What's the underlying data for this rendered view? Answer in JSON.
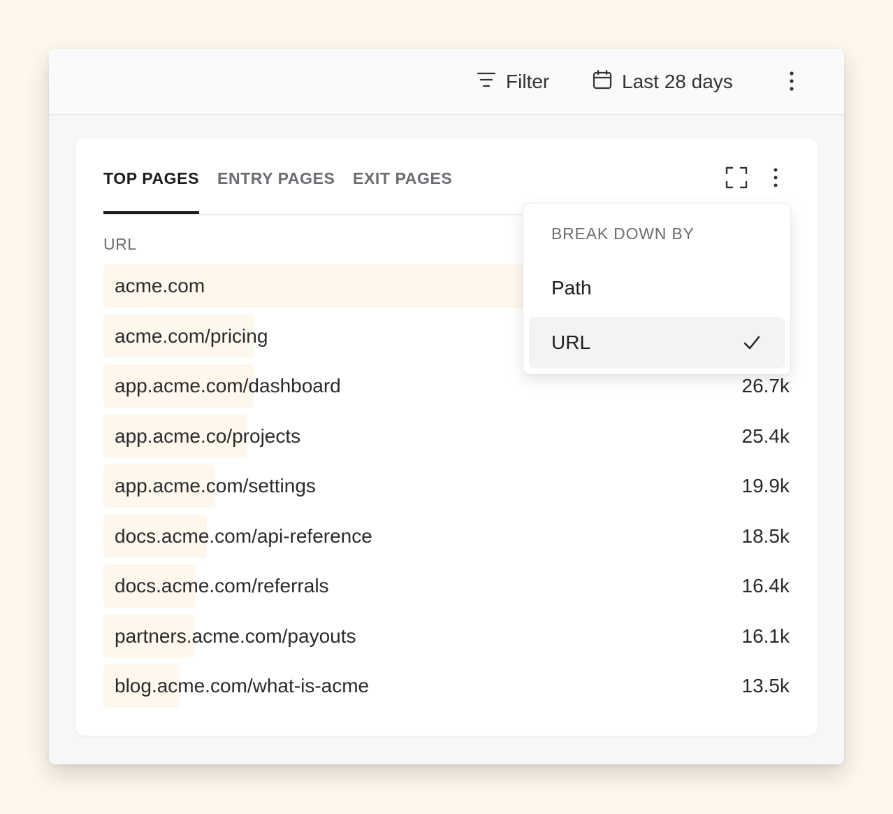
{
  "toolbar": {
    "filter_label": "Filter",
    "date_range_label": "Last 28 days"
  },
  "tabs": [
    {
      "label": "TOP PAGES",
      "active": true
    },
    {
      "label": "ENTRY PAGES",
      "active": false
    },
    {
      "label": "EXIT PAGES",
      "active": false
    }
  ],
  "table": {
    "column_header": "URL",
    "rows": [
      {
        "label": "acme.com",
        "value": "",
        "share": 1.0
      },
      {
        "label": "acme.com/pricing",
        "value": "",
        "share": 0.22
      },
      {
        "label": "app.acme.com/dashboard",
        "value": "26.7k",
        "share": 0.22
      },
      {
        "label": "app.acme.co/projects",
        "value": "25.4k",
        "share": 0.21
      },
      {
        "label": "app.acme.com/settings",
        "value": "19.9k",
        "share": 0.163
      },
      {
        "label": "docs.acme.com/api-reference",
        "value": "18.5k",
        "share": 0.151
      },
      {
        "label": "docs.acme.com/referrals",
        "value": "16.4k",
        "share": 0.134
      },
      {
        "label": "partners.acme.com/payouts",
        "value": "16.1k",
        "share": 0.132
      },
      {
        "label": "blog.acme.com/what-is-acme",
        "value": "13.5k",
        "share": 0.111
      }
    ]
  },
  "dropdown": {
    "heading": "BREAK DOWN BY",
    "options": [
      {
        "label": "Path",
        "selected": false
      },
      {
        "label": "URL",
        "selected": true
      }
    ]
  },
  "colors": {
    "page_background": "#fdf7ec",
    "bar_fill": "#fdf7ec",
    "text_primary": "#1f1f23",
    "text_muted": "#6b6b72"
  },
  "icons": {
    "filter": "filter-icon",
    "calendar": "calendar-icon",
    "more": "more-vertical-icon",
    "expand": "expand-icon",
    "check": "check-icon"
  }
}
